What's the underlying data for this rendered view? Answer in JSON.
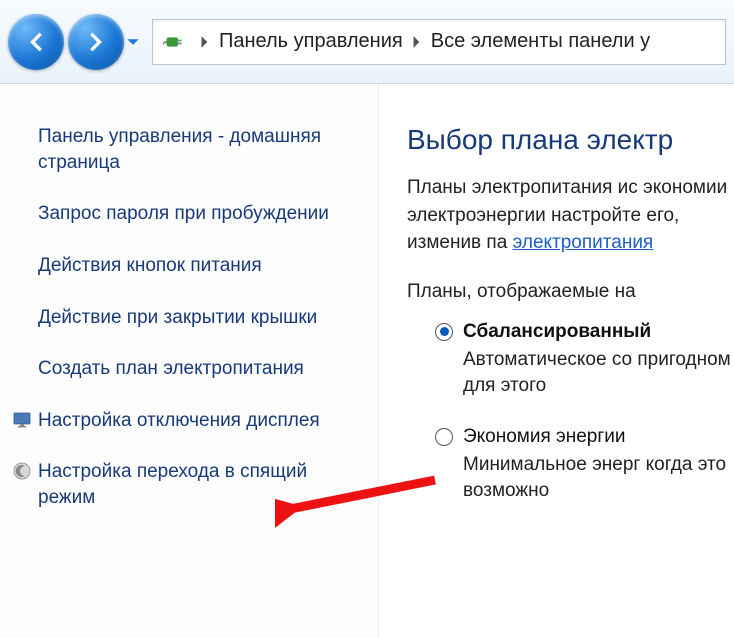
{
  "breadcrumb": {
    "items": [
      {
        "label": "Панель управления"
      },
      {
        "label": "Все элементы панели у"
      }
    ]
  },
  "sidebar": {
    "home": "Панель управления - домашняя страница",
    "links": [
      {
        "label": "Запрос пароля при пробуждении"
      },
      {
        "label": "Действия кнопок питания"
      },
      {
        "label": "Действие при закрытии крышки"
      },
      {
        "label": "Создать план электропитания"
      },
      {
        "label": "Настройка отключения дисплея",
        "icon": "monitor"
      },
      {
        "label": "Настройка перехода в спящий режим",
        "icon": "moon"
      }
    ]
  },
  "main": {
    "title": "Выбор плана электр",
    "desc_pre": "Планы электропитания ис экономии электроэнергии настройте его, изменив па ",
    "desc_link": "электропитания",
    "subhead": "Планы, отображаемые на",
    "plans": [
      {
        "name": "Сбалансированный",
        "selected": true,
        "desc": "Автоматическое со пригодном для этого"
      },
      {
        "name": "Экономия энергии",
        "selected": false,
        "desc": "Минимальное энерг когда это возможно"
      }
    ]
  }
}
